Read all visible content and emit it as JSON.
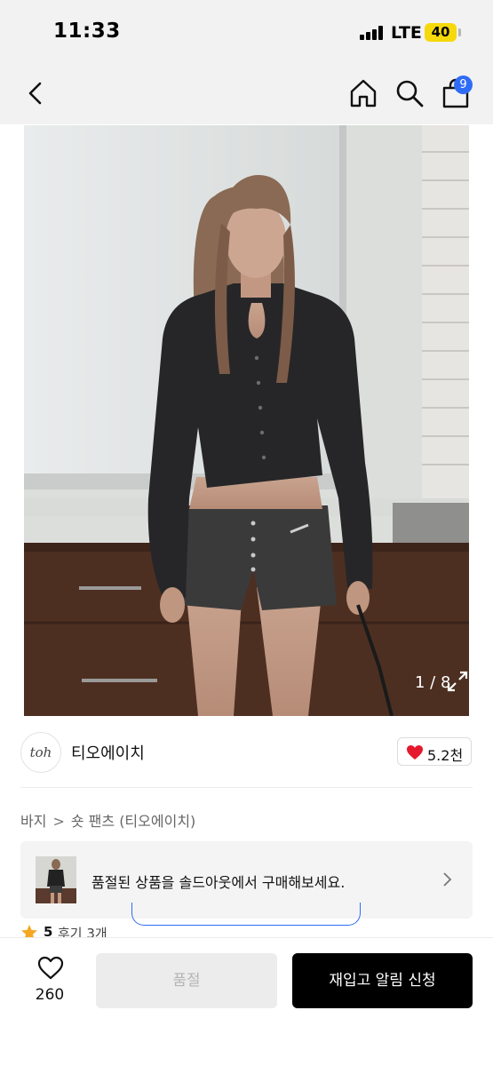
{
  "status_bar": {
    "time": "11:33",
    "network": "LTE",
    "battery": "40"
  },
  "nav": {
    "cart_badge": "9"
  },
  "photo": {
    "counter": "1 / 8"
  },
  "brand": {
    "logo_text": "toh",
    "name": "티오에이치",
    "likes": "5.2천"
  },
  "breadcrumb": [
    "바지",
    "숏 팬츠 (티오에이치)"
  ],
  "banner": {
    "text": "품절된 상품을 솔드아웃에서 구매해보세요."
  },
  "rating": {
    "value": "5",
    "reviews": "후기 3개"
  },
  "bottom": {
    "wish_count": "260",
    "soldout_label": "품절",
    "restock_label": "재입고 알림 신청"
  },
  "colors": {
    "accent": "#2f6cf6",
    "like_red": "#e5192d",
    "battery": "#f5d90a"
  },
  "icons": [
    "back-arrow-icon",
    "home-icon",
    "search-icon",
    "shopping-bag-icon",
    "expand-icon",
    "heart-icon",
    "chevron-right-icon",
    "star-icon"
  ]
}
